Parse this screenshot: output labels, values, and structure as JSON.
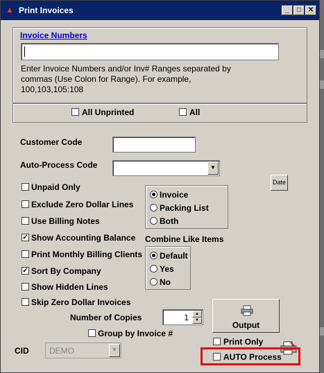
{
  "window": {
    "title": "Print Invoices"
  },
  "invoice_numbers": {
    "heading": "Invoice Numbers",
    "value": "",
    "help_line1": "Enter Invoice Numbers and/or Inv# Ranges separated by",
    "help_line2": "commas (Use Colon for Range).  For example,",
    "help_line3": "100,103,105:108"
  },
  "filters": {
    "all_unprinted": "All Unprinted",
    "all": "All"
  },
  "customer_code": {
    "label": "Customer Code",
    "value": ""
  },
  "auto_process_code": {
    "label": "Auto-Process Code",
    "value": ""
  },
  "date_button": "Date",
  "options": [
    {
      "label": "Unpaid Only",
      "checked": false
    },
    {
      "label": "Exclude Zero Dollar Lines",
      "checked": false
    },
    {
      "label": "Use Billing Notes",
      "checked": false
    },
    {
      "label": "Show Accounting Balance",
      "checked": true
    },
    {
      "label": "Print Monthly Billing Clients",
      "checked": false
    },
    {
      "label": "Sort By Company",
      "checked": true
    },
    {
      "label": "Show Hidden Lines",
      "checked": false
    },
    {
      "label": "Skip Zero Dollar Invoices",
      "checked": false
    }
  ],
  "doc_type": {
    "options": [
      "Invoice",
      "Packing List",
      "Both"
    ],
    "selected": "Invoice"
  },
  "combine": {
    "heading": "Combine Like Items",
    "options": [
      "Default",
      "Yes",
      "No"
    ],
    "selected": "Default"
  },
  "copies": {
    "label": "Number of Copies",
    "value": "1"
  },
  "group_by_invoice": "Group by Invoice #",
  "cid": {
    "label": "CID",
    "value": "DEMO"
  },
  "output_button": "Output",
  "print_only": "Print Only",
  "auto_process": "AUTO Process",
  "icons": {
    "printer": "printer-icon",
    "dropdown": "chevron-down-icon",
    "app": "app-icon",
    "accent": "#e01010"
  }
}
